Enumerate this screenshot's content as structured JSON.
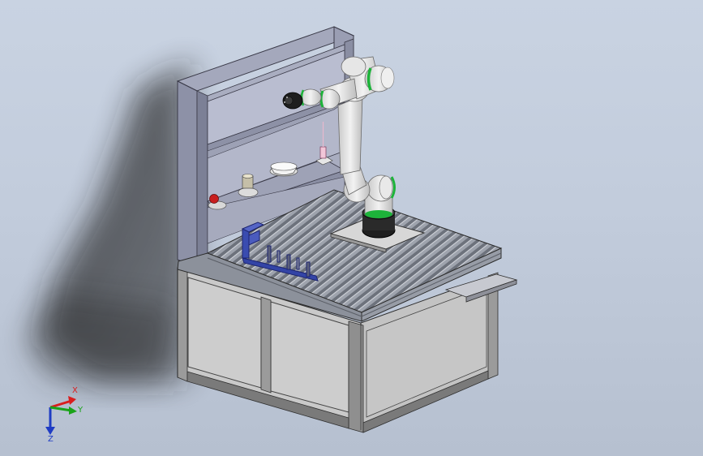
{
  "viewport": {
    "background_top": "#c9d3e2",
    "background_bottom": "#b6c0d0"
  },
  "model": {
    "frame_color": "#8f93a8",
    "tabletop_color": "#9aa0ab",
    "cabinet_color": "#c2c2c2",
    "robot_body_color": "#e4e4e4",
    "robot_accent_color": "#1db33a",
    "fixture_color": "#3848a8"
  },
  "triad": {
    "x_label": "X",
    "y_label": "Y",
    "z_label": "Z",
    "x_color": "#d91e1e",
    "y_color": "#1aa31a",
    "z_color": "#1f3cc4"
  }
}
